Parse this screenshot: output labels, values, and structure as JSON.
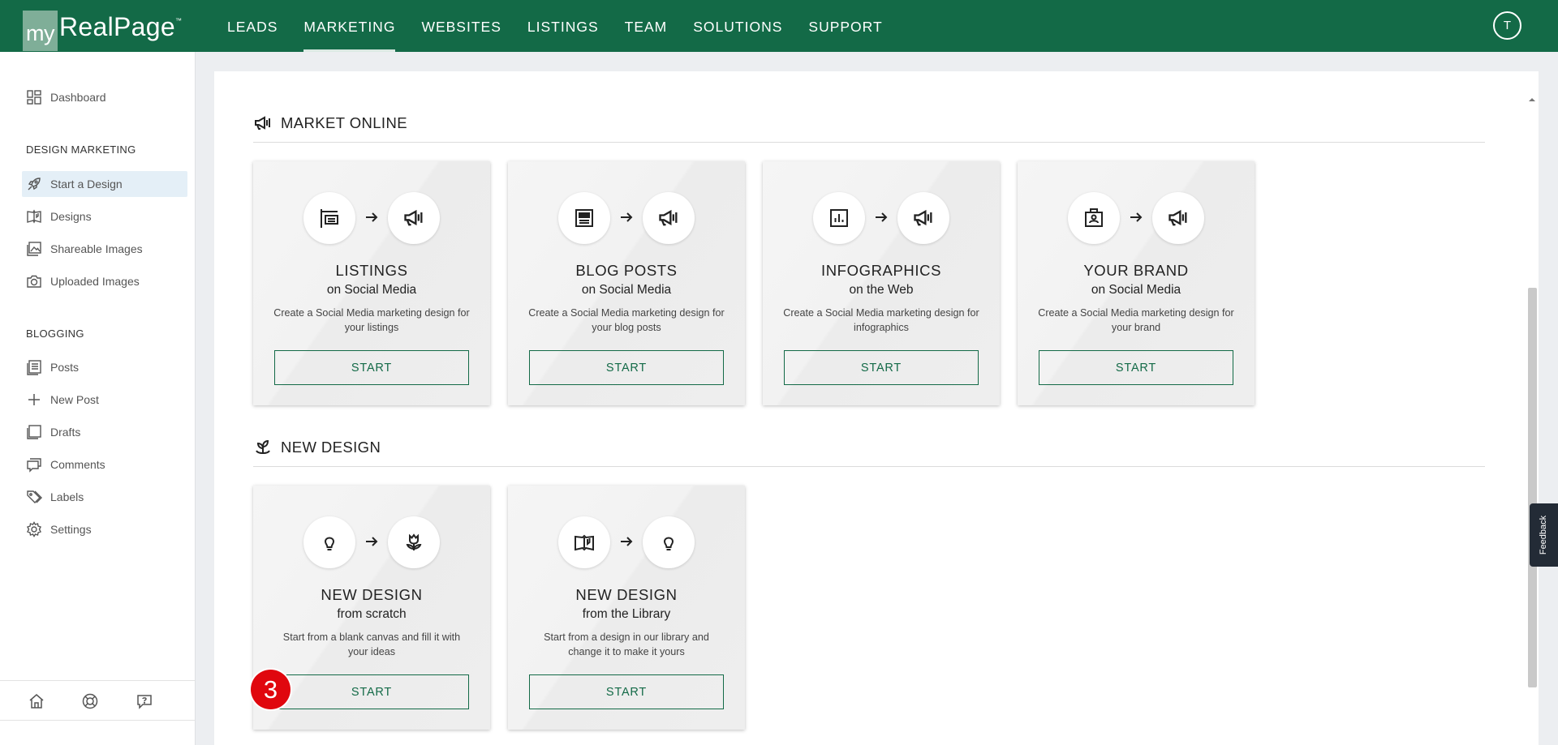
{
  "brand": {
    "logo_my": "my",
    "logo_name": "RealPage",
    "logo_tm": "™"
  },
  "nav": {
    "items": [
      {
        "label": "LEADS"
      },
      {
        "label": "MARKETING",
        "active": true
      },
      {
        "label": "WEBSITES"
      },
      {
        "label": "LISTINGS"
      },
      {
        "label": "TEAM"
      },
      {
        "label": "SOLUTIONS"
      },
      {
        "label": "SUPPORT"
      }
    ],
    "avatar_initial": "T"
  },
  "sidebar": {
    "dashboard": "Dashboard",
    "design_marketing_header": "DESIGN MARKETING",
    "design_items": [
      {
        "label": "Start a Design",
        "icon": "rocket-icon",
        "active": true
      },
      {
        "label": "Designs",
        "icon": "book-icon"
      },
      {
        "label": "Shareable Images",
        "icon": "images-icon"
      },
      {
        "label": "Uploaded Images",
        "icon": "camera-icon"
      }
    ],
    "blogging_header": "BLOGGING",
    "blog_items": [
      {
        "label": "Posts",
        "icon": "posts-icon"
      },
      {
        "label": "New Post",
        "icon": "plus-icon"
      },
      {
        "label": "Drafts",
        "icon": "drafts-icon"
      },
      {
        "label": "Comments",
        "icon": "comments-icon"
      },
      {
        "label": "Labels",
        "icon": "tag-icon"
      },
      {
        "label": "Settings",
        "icon": "gear-icon"
      }
    ]
  },
  "sections": {
    "market_online": {
      "title": "MARKET ONLINE",
      "cards": [
        {
          "title": "LISTINGS",
          "subtitle": "on Social Media",
          "description": "Create a Social Media marketing design for your listings",
          "button": "START"
        },
        {
          "title": "BLOG POSTS",
          "subtitle": "on Social Media",
          "description": "Create a Social Media marketing design for your blog posts",
          "button": "START"
        },
        {
          "title": "INFOGRAPHICS",
          "subtitle": "on the Web",
          "description": "Create a Social Media marketing design for infographics",
          "button": "START"
        },
        {
          "title": "YOUR BRAND",
          "subtitle": "on Social Media",
          "description": "Create a Social Media marketing design for your brand",
          "button": "START"
        }
      ]
    },
    "new_design": {
      "title": "NEW DESIGN",
      "cards": [
        {
          "title": "NEW DESIGN",
          "subtitle": "from scratch",
          "description": "Start from a blank canvas and fill it with your ideas",
          "button": "START"
        },
        {
          "title": "NEW DESIGN",
          "subtitle": "from the Library",
          "description": "Start from a design in our library and change it to make it yours",
          "button": "START"
        }
      ]
    }
  },
  "feedback_label": "Feedback",
  "step_badge": "3",
  "colors": {
    "brand_green": "#136a47",
    "badge_red": "#e0070e",
    "active_item_bg": "#e4eff7"
  }
}
